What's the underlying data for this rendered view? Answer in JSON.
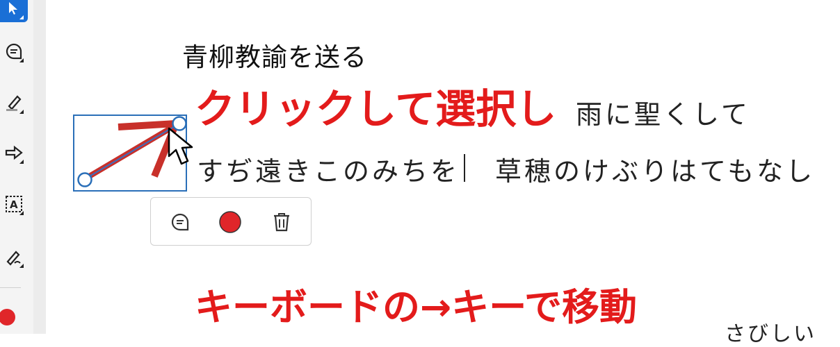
{
  "toolbar": {
    "tools": [
      {
        "icon": "select-pointer-icon",
        "active": true
      },
      {
        "icon": "comment-icon"
      },
      {
        "icon": "highlighter-icon"
      },
      {
        "icon": "arrow-shape-icon"
      },
      {
        "icon": "text-box-icon"
      },
      {
        "icon": "signature-pen-icon"
      }
    ],
    "current_color": "#e0262a"
  },
  "document": {
    "title": "青柳教諭を送る",
    "line1_fragment": "雨に聖くして",
    "line2_left": "すぢ遠きこのみちを",
    "line2_right": "草穂のけぶりはてもなし",
    "bottom_fragment": "さびしい"
  },
  "captions": {
    "click_select": "クリックして選択し",
    "keyboard_move": "キーボードの→キーで移動"
  },
  "popup": {
    "buttons": [
      "comment-icon",
      "color-swatch",
      "trash-icon"
    ],
    "swatch_color": "#e0262a"
  },
  "colors": {
    "accent": "#1a6fd6",
    "caption_red": "#e31b1b",
    "selection_blue": "#2a6fb8"
  }
}
